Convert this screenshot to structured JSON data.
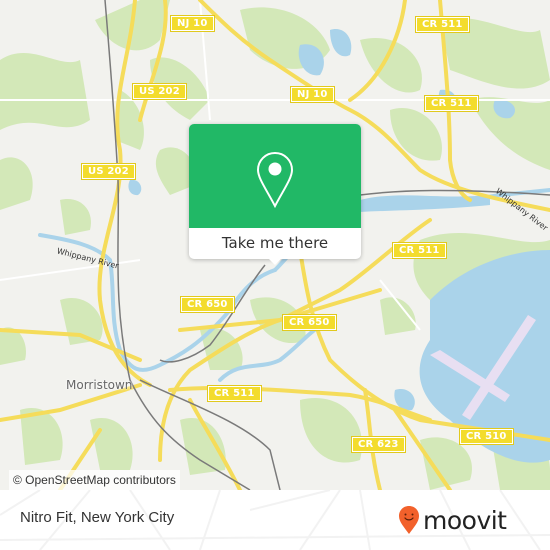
{
  "map": {
    "shields": [
      {
        "id": "nj10-top",
        "label": "NJ 10"
      },
      {
        "id": "cr511-top",
        "label": "CR 511"
      },
      {
        "id": "us202-a",
        "label": "US 202"
      },
      {
        "id": "nj10-mid",
        "label": "NJ 10"
      },
      {
        "id": "cr511-mid",
        "label": "CR 511"
      },
      {
        "id": "us202-b",
        "label": "US 202"
      },
      {
        "id": "cr511-right",
        "label": "CR 511"
      },
      {
        "id": "cr650-left",
        "label": "CR 650"
      },
      {
        "id": "cr650-right",
        "label": "CR 650"
      },
      {
        "id": "cr511-bottom",
        "label": "CR 511"
      },
      {
        "id": "cr623",
        "label": "CR 623"
      },
      {
        "id": "cr510",
        "label": "CR 510"
      }
    ],
    "places": [
      {
        "id": "morristown",
        "label": "Morristown"
      }
    ],
    "rivers": [
      {
        "id": "whippany-left",
        "label": "Whippany River"
      },
      {
        "id": "whippany-right",
        "label": "Whippany River"
      }
    ],
    "attribution": "© OpenStreetMap contributors",
    "colors": {
      "land": "#f2f2ee",
      "forest": "#cfe6b0",
      "water": "#a9d5ec",
      "road": "#f5dc5a",
      "runway": "#e6dcf0",
      "rail": "#777777"
    }
  },
  "popup": {
    "icon": "map-pin-icon",
    "cta_label": "Take me there",
    "accent": "#21b866"
  },
  "footer": {
    "place_name": "Nitro Fit, New York City",
    "brand": {
      "icon": "moovit-pin-icon",
      "wordmark": "moovit",
      "icon_color": "#f2612b"
    }
  }
}
